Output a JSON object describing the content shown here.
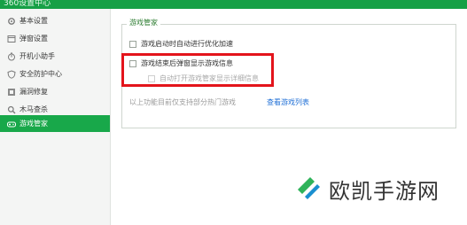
{
  "window": {
    "title": "360设置中心"
  },
  "sidebar": {
    "items": [
      {
        "label": "基本设置",
        "icon": "gear-icon",
        "active": false
      },
      {
        "label": "弹窗设置",
        "icon": "popup-icon",
        "active": false
      },
      {
        "label": "开机小助手",
        "icon": "timer-icon",
        "active": false
      },
      {
        "label": "安全防护中心",
        "icon": "shield-icon",
        "active": false
      },
      {
        "label": "漏洞修复",
        "icon": "patch-icon",
        "active": false
      },
      {
        "label": "木马查杀",
        "icon": "scan-icon",
        "active": false
      },
      {
        "label": "游戏管家",
        "icon": "gamepad-icon",
        "active": true
      }
    ]
  },
  "main": {
    "group_title": "游戏管家",
    "options": [
      {
        "label": "游戏启动时自动进行优化加速",
        "checked": false,
        "disabled": false
      },
      {
        "label": "游戏结束后弹窗显示游戏信息",
        "checked": false,
        "disabled": false
      },
      {
        "label": "自动打开游戏管家显示详细信息",
        "checked": false,
        "disabled": true
      }
    ],
    "note": "以上功能目前仅支持部分热门游戏",
    "link": "查看游戏列表"
  },
  "watermark": {
    "text": "欧凯手游网"
  },
  "colors": {
    "accent": "#18a84a",
    "highlight": "#e3141b",
    "link": "#1f6fd6"
  }
}
